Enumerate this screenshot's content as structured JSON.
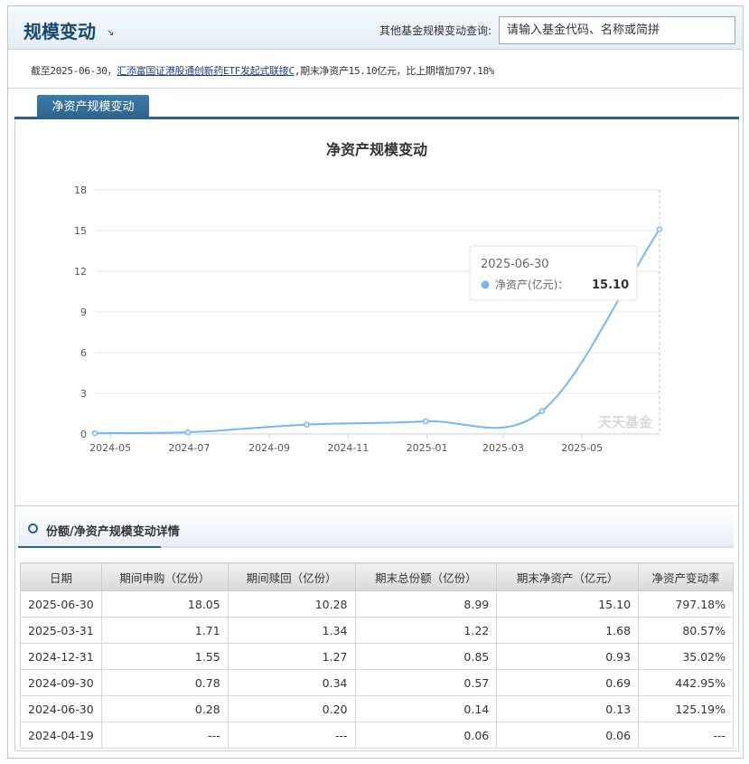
{
  "header": {
    "title": "规模变动",
    "search_label": "其他基金规模变动查询:",
    "search_placeholder": "请输入基金代码、名称或简拼"
  },
  "info": {
    "prefix": "截至2025-06-30，",
    "fund_name": "汇添富国证港股通创新药ETF发起式联接C",
    "suffix": ",期末净资产15.10亿元，比上期增加797.18%"
  },
  "tab": {
    "label": "净资产规模变动"
  },
  "chart_data": {
    "type": "line",
    "title": "净资产规模变动",
    "x_tick_labels": [
      "2024-05",
      "2024-07",
      "2024-09",
      "2024-11",
      "2025-01",
      "2025-03",
      "2025-05"
    ],
    "y_ticks": [
      0,
      3,
      6,
      9,
      12,
      15,
      18
    ],
    "ylim": [
      0,
      18
    ],
    "series": [
      {
        "name": "净资产(亿元)",
        "color": "#7cb5ec",
        "points": [
          {
            "date": "2024-04-19",
            "value": 0.06
          },
          {
            "date": "2024-06-30",
            "value": 0.13
          },
          {
            "date": "2024-09-30",
            "value": 0.69
          },
          {
            "date": "2024-12-31",
            "value": 0.93
          },
          {
            "date": "2025-03-31",
            "value": 1.68
          },
          {
            "date": "2025-06-30",
            "value": 15.1
          }
        ]
      }
    ],
    "tooltip": {
      "date": "2025-06-30",
      "label": "净资产(亿元)：",
      "value": "15.10"
    },
    "watermark": "天天基金",
    "grid": true,
    "legend": "none"
  },
  "detail": {
    "title": "份额/净资产规模变动详情",
    "columns": [
      "日期",
      "期间申购（亿份）",
      "期间赎回（亿份）",
      "期末总份额（亿份）",
      "期末净资产（亿元）",
      "净资产变动率"
    ],
    "rows": [
      [
        "2025-06-30",
        "18.05",
        "10.28",
        "8.99",
        "15.10",
        "797.18%"
      ],
      [
        "2025-03-31",
        "1.71",
        "1.34",
        "1.22",
        "1.68",
        "80.57%"
      ],
      [
        "2024-12-31",
        "1.55",
        "1.27",
        "0.85",
        "0.93",
        "35.02%"
      ],
      [
        "2024-09-30",
        "0.78",
        "0.34",
        "0.57",
        "0.69",
        "442.95%"
      ],
      [
        "2024-06-30",
        "0.28",
        "0.20",
        "0.14",
        "0.13",
        "125.19%"
      ],
      [
        "2024-04-19",
        "---",
        "---",
        "0.06",
        "0.06",
        "---"
      ]
    ]
  }
}
